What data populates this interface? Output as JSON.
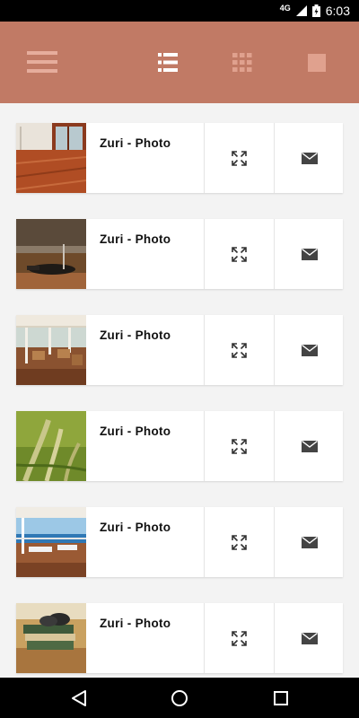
{
  "status_bar": {
    "network": "4G",
    "time": "6:03"
  },
  "toolbar": {
    "icons": [
      "menu-icon",
      "list-view-icon",
      "grid-view-icon",
      "single-view-icon"
    ],
    "accent_color": "#c17a65"
  },
  "photos": [
    {
      "title": "Zuri - Photo",
      "thumbnail": "wooden-deck"
    },
    {
      "title": "Zuri - Photo",
      "thumbnail": "table-setting"
    },
    {
      "title": "Zuri - Photo",
      "thumbnail": "restaurant-interior"
    },
    {
      "title": "Zuri - Photo",
      "thumbnail": "grass-closeup"
    },
    {
      "title": "Zuri - Photo",
      "thumbnail": "sea-view-terrace"
    },
    {
      "title": "Zuri - Photo",
      "thumbnail": "books-on-table"
    }
  ],
  "actions": {
    "expand_icon": "expand-icon",
    "mail_icon": "mail-icon"
  },
  "nav_bar": {
    "icons": [
      "back-icon",
      "home-icon",
      "recent-apps-icon"
    ]
  }
}
